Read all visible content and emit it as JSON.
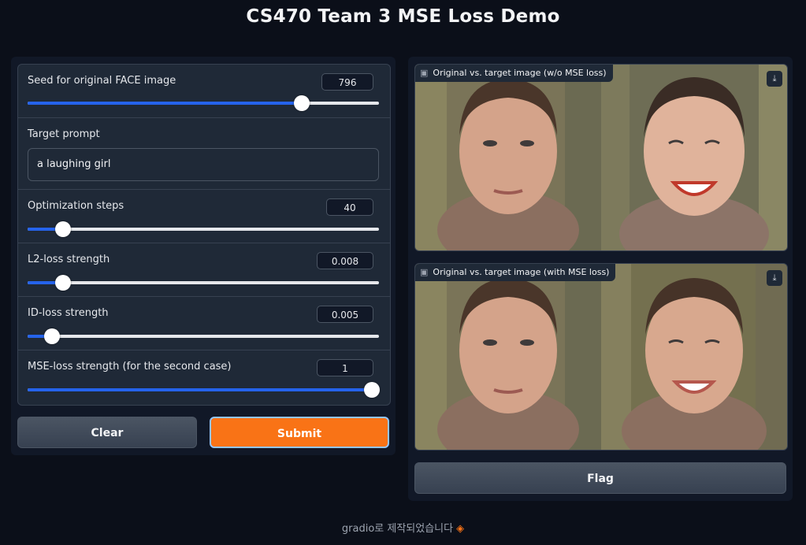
{
  "app_title": "CS470 Team 3 MSE Loss Demo",
  "controls": {
    "seed": {
      "label": "Seed for original FACE image",
      "value": "796",
      "fraction": 0.78
    },
    "prompt": {
      "label": "Target prompt",
      "value": "a laughing girl"
    },
    "steps": {
      "label": "Optimization steps",
      "value": "40",
      "fraction": 0.1
    },
    "l2": {
      "label": "L2-loss strength",
      "value": "0.008",
      "fraction": 0.1
    },
    "id": {
      "label": "ID-loss strength",
      "value": "0.005",
      "fraction": 0.07
    },
    "mse": {
      "label": "MSE-loss strength (for the second case)",
      "value": "1",
      "fraction": 1.0
    }
  },
  "buttons": {
    "clear": "Clear",
    "submit": "Submit",
    "flag": "Flag"
  },
  "outputs": {
    "first_label": "Original vs. target image (w/o MSE loss)",
    "second_label": "Original vs. target image (with MSE loss)"
  },
  "footer": {
    "text": "gradio로 제작되었습니다"
  },
  "colors": {
    "accent": "#f97316",
    "slider": "#2563eb",
    "background": "#0b0f19"
  }
}
